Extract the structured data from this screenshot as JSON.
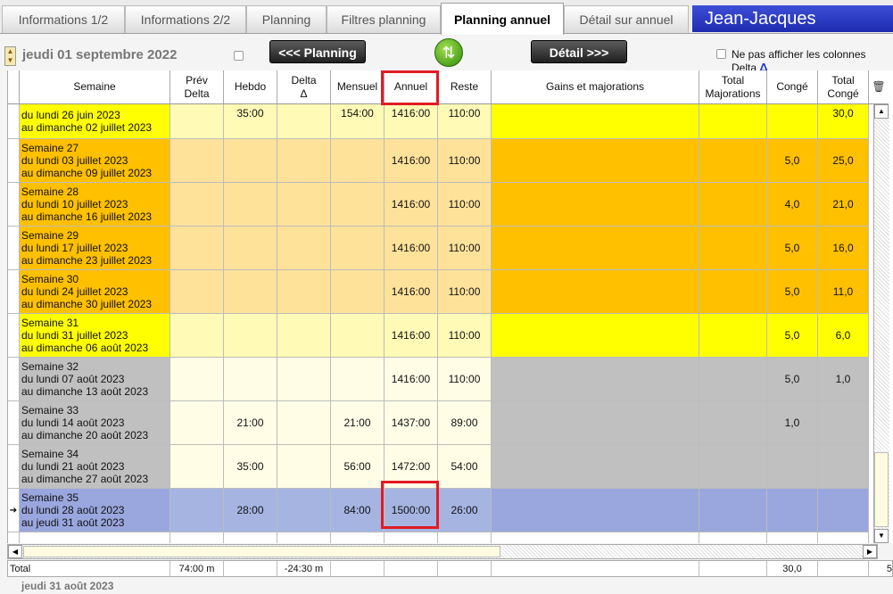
{
  "tabs": [
    {
      "label": "Informations 1/2",
      "active": false
    },
    {
      "label": "Informations 2/2",
      "active": false
    },
    {
      "label": "Planning",
      "active": false
    },
    {
      "label": "Filtres planning",
      "active": false
    },
    {
      "label": "Planning annuel",
      "active": true
    },
    {
      "label": "Détail sur annuel",
      "active": false
    }
  ],
  "user_name": "Jean-Jacques",
  "toolbar": {
    "date": "jeudi 01 septembre 2022",
    "planning_button": "<<< Planning",
    "detail_button": "Détail >>>",
    "hide_delta_label": "Ne pas afficher les colonnes Delta",
    "delta_symbol": "Δ"
  },
  "columns": [
    {
      "key": "semaine",
      "label": "Semaine"
    },
    {
      "key": "prev_delta",
      "label": "Prév\nDelta"
    },
    {
      "key": "hebdo",
      "label": "Hebdo"
    },
    {
      "key": "delta",
      "label": "Delta\nΔ"
    },
    {
      "key": "mensuel",
      "label": "Mensuel"
    },
    {
      "key": "annuel",
      "label": "Annuel"
    },
    {
      "key": "reste",
      "label": "Reste"
    },
    {
      "key": "gains",
      "label": "Gains et majorations"
    },
    {
      "key": "total_maj",
      "label": "Total\nMajorations"
    },
    {
      "key": "conge",
      "label": "Congé"
    },
    {
      "key": "total_conge",
      "label": "Total\nCongé"
    }
  ],
  "rows": [
    {
      "semaine": [
        "du lundi 26 juin 2023",
        "au dimanche 02 juillet 2023"
      ],
      "prev_delta": "",
      "hebdo": "35:00",
      "delta": "",
      "mensuel": "154:00",
      "annuel": "1416:00",
      "reste": "110:00",
      "gains": "",
      "total_maj": "",
      "conge": "",
      "total_conge": "30,0",
      "color": "yellow"
    },
    {
      "semaine": [
        "Semaine 27",
        "du lundi 03 juillet 2023",
        "au dimanche 09 juillet 2023"
      ],
      "prev_delta": "",
      "hebdo": "",
      "delta": "",
      "mensuel": "",
      "annuel": "1416:00",
      "reste": "110:00",
      "gains": "",
      "total_maj": "",
      "conge": "5,0",
      "total_conge": "25,0",
      "color": "orange"
    },
    {
      "semaine": [
        "Semaine 28",
        "du lundi 10 juillet 2023",
        "au dimanche 16 juillet 2023"
      ],
      "prev_delta": "",
      "hebdo": "",
      "delta": "",
      "mensuel": "",
      "annuel": "1416:00",
      "reste": "110:00",
      "gains": "",
      "total_maj": "",
      "conge": "4,0",
      "total_conge": "21,0",
      "color": "orange"
    },
    {
      "semaine": [
        "Semaine 29",
        "du lundi 17 juillet 2023",
        "au dimanche 23 juillet 2023"
      ],
      "prev_delta": "",
      "hebdo": "",
      "delta": "",
      "mensuel": "",
      "annuel": "1416:00",
      "reste": "110:00",
      "gains": "",
      "total_maj": "",
      "conge": "5,0",
      "total_conge": "16,0",
      "color": "orange"
    },
    {
      "semaine": [
        "Semaine 30",
        "du lundi 24 juillet 2023",
        "au dimanche 30 juillet 2023"
      ],
      "prev_delta": "",
      "hebdo": "",
      "delta": "",
      "mensuel": "",
      "annuel": "1416:00",
      "reste": "110:00",
      "gains": "",
      "total_maj": "",
      "conge": "5,0",
      "total_conge": "11,0",
      "color": "orange"
    },
    {
      "semaine": [
        "Semaine 31",
        "du lundi 31 juillet 2023",
        "au dimanche 06 août 2023"
      ],
      "prev_delta": "",
      "hebdo": "",
      "delta": "",
      "mensuel": "",
      "annuel": "1416:00",
      "reste": "110:00",
      "gains": "",
      "total_maj": "",
      "conge": "5,0",
      "total_conge": "6,0",
      "color": "yellow"
    },
    {
      "semaine": [
        "Semaine 32",
        "du lundi 07 août 2023",
        "au dimanche 13 août 2023"
      ],
      "prev_delta": "",
      "hebdo": "",
      "delta": "",
      "mensuel": "",
      "annuel": "1416:00",
      "reste": "110:00",
      "gains": "",
      "total_maj": "",
      "conge": "5,0",
      "total_conge": "1,0",
      "color": "gray"
    },
    {
      "semaine": [
        "Semaine 33",
        "du lundi 14 août 2023",
        "au dimanche 20 août 2023"
      ],
      "prev_delta": "",
      "hebdo": "21:00",
      "delta": "",
      "mensuel": "21:00",
      "annuel": "1437:00",
      "reste": "89:00",
      "gains": "",
      "total_maj": "",
      "conge": "1,0",
      "total_conge": "",
      "color": "gray"
    },
    {
      "semaine": [
        "Semaine 34",
        "du lundi 21 août 2023",
        "au dimanche 27 août 2023"
      ],
      "prev_delta": "",
      "hebdo": "35:00",
      "delta": "",
      "mensuel": "56:00",
      "annuel": "1472:00",
      "reste": "54:00",
      "gains": "",
      "total_maj": "",
      "conge": "",
      "total_conge": "",
      "color": "gray"
    },
    {
      "semaine": [
        "Semaine 35",
        "du lundi 28 août 2023",
        "au jeudi 31 août 2023"
      ],
      "prev_delta": "",
      "hebdo": "28:00",
      "delta": "",
      "mensuel": "84:00",
      "annuel": "1500:00",
      "reste": "26:00",
      "gains": "",
      "total_maj": "",
      "conge": "",
      "total_conge": "",
      "color": "selected"
    }
  ],
  "totals": {
    "label": "Total",
    "prev_delta": "74:00 m",
    "delta": "-24:30 m",
    "conge": "30,0",
    "extra": "5"
  },
  "footer_date": "jeudi 31 août 2023",
  "colors": {
    "yellow": "#ffff00",
    "orange": "#ffc000",
    "gray": "#c0c0c0",
    "selected": "#a6b4e2",
    "light_yellow": "#fffde6",
    "light_orange": "#ffe29a",
    "highlight": "#e11b25"
  }
}
